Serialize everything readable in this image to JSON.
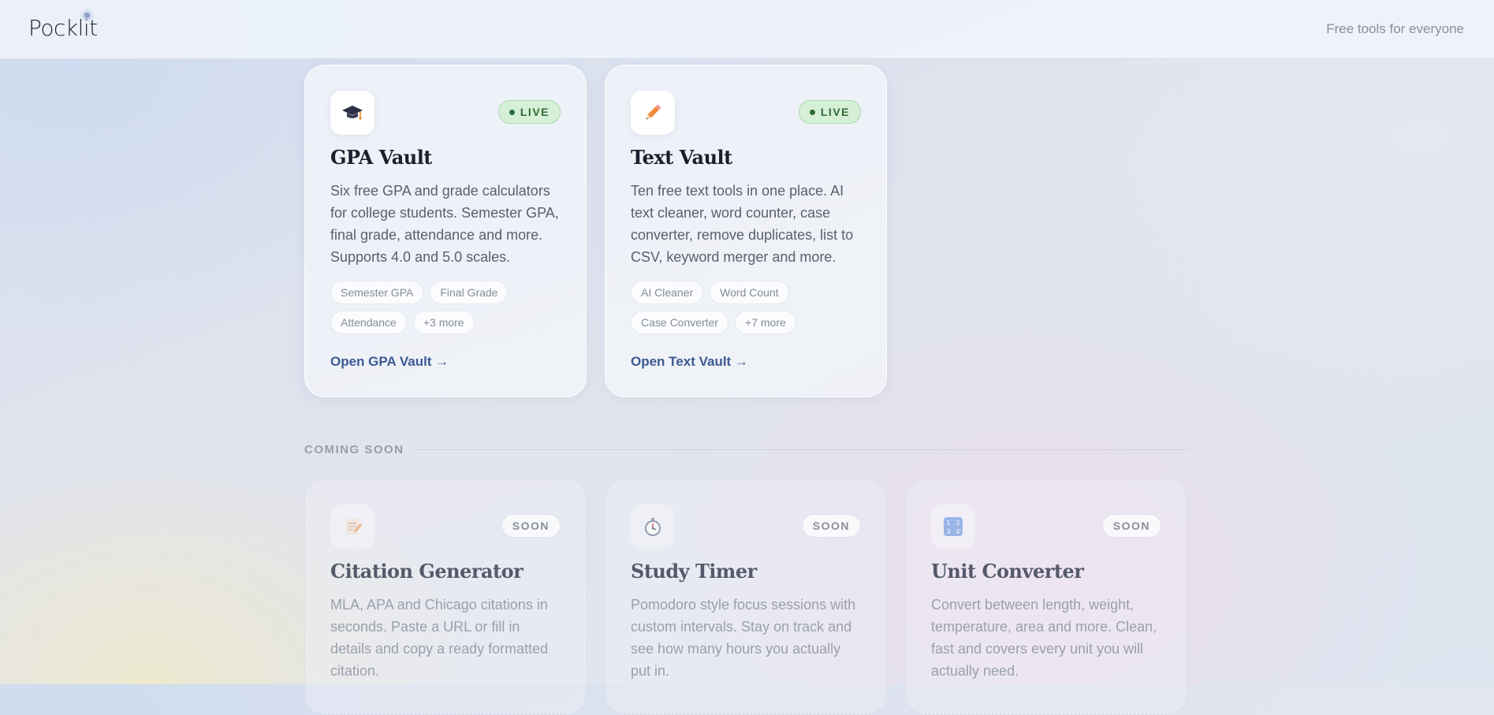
{
  "header": {
    "logo": "Pocklit",
    "tagline": "Free tools for everyone"
  },
  "live_cards": [
    {
      "icon": "graduation-cap-icon",
      "badge": "LIVE",
      "title": "GPA Vault",
      "description": "Six free GPA and grade calculators for college students. Semester GPA, final grade, attendance and more. Supports 4.0 and 5.0 scales.",
      "tags": [
        "Semester GPA",
        "Final Grade",
        "Attendance",
        "+3 more"
      ],
      "link": "Open GPA Vault →"
    },
    {
      "icon": "pencil-icon",
      "badge": "LIVE",
      "title": "Text Vault",
      "description": "Ten free text tools in one place. AI text cleaner, word counter, case converter, remove duplicates, list to CSV, keyword merger and more.",
      "tags": [
        "AI Cleaner",
        "Word Count",
        "Case Converter",
        "+7 more"
      ],
      "link": "Open Text Vault →"
    }
  ],
  "coming_soon": {
    "label": "COMING SOON",
    "cards": [
      {
        "icon": "memo-icon",
        "badge": "SOON",
        "title": "Citation Generator",
        "description": "MLA, APA and Chicago citations in seconds. Paste a URL or fill in details and copy a ready formatted citation."
      },
      {
        "icon": "stopwatch-icon",
        "badge": "SOON",
        "title": "Study Timer",
        "description": "Pomodoro style focus sessions with custom intervals. Stay on track and see how many hours you actually put in."
      },
      {
        "icon": "numbers-icon",
        "badge": "SOON",
        "title": "Unit Converter",
        "description": "Convert between length, weight, temperature, area and more. Clean, fast and covers every unit you will actually need."
      }
    ]
  }
}
